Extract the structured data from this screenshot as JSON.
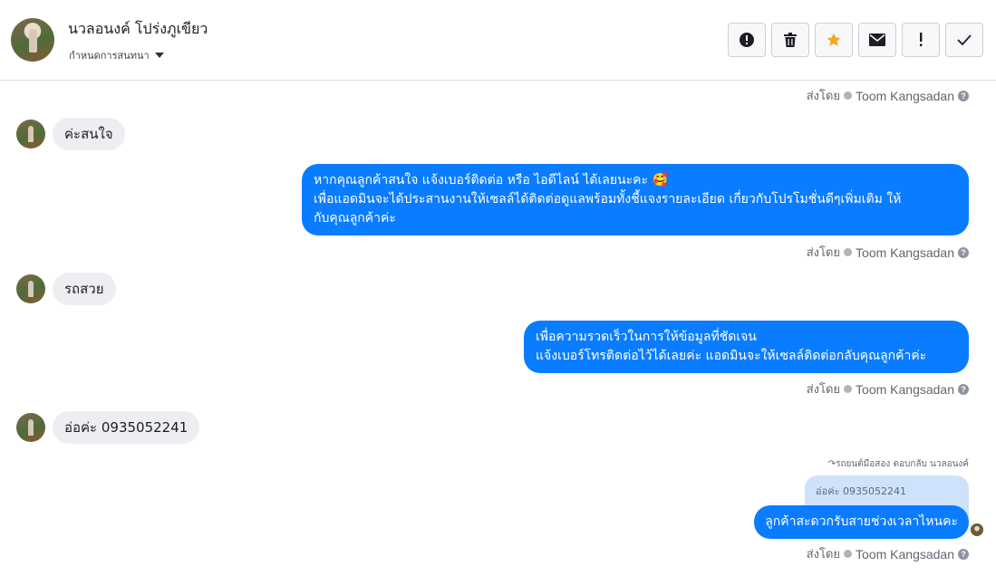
{
  "header": {
    "contact_name": "นวลอนงค์ โปร่งภูเขียว",
    "assign_label": "กำหนดการสนทนา",
    "toolbar": [
      {
        "name": "spam-button",
        "icon": "alert-circle-icon"
      },
      {
        "name": "delete-button",
        "icon": "trash-icon"
      },
      {
        "name": "star-button",
        "icon": "star-icon",
        "color": "#f5a623"
      },
      {
        "name": "mark-unread-button",
        "icon": "envelope-icon"
      },
      {
        "name": "follow-up-button",
        "icon": "exclamation-icon"
      },
      {
        "name": "mark-done-button",
        "icon": "check-icon"
      }
    ]
  },
  "sent_by": {
    "prefix": "ส่งโดย",
    "agent": "Toom Kangsadan",
    "help": "?"
  },
  "messages": {
    "m1": "ค่ะสนใจ",
    "m2_line1": "หากคุณลูกค้าสนใจ แจ้งเบอร์ติดต่อ หรือ ไอดีไลน์ ได้เลยนะคะ 🥰",
    "m2_line2": "เพื่อแอดมินจะได้ประสานงานให้เซลล์ได้ติดต่อดูแลพร้อมทั้งชี้แจงรายละเอียด เกี่ยวกับโปรโมชั่นดีๆเพิ่มเติม ให้",
    "m2_line3": "กับคุณลูกค้าค่ะ",
    "m3": "รถสวย",
    "m4_line1": "เพื่อความรวดเร็วในการให้ข้อมูลที่ชัดเจน",
    "m4_line2": "แจ้งเบอร์โทรติดต่อไว้ได้เลยค่ะ แอดมินจะให้เซลล์ติดต่อกลับคุณลูกค้าค่ะ",
    "m5": "อ่อค่ะ 0935052241",
    "reply_note": "↷รถยนต์มือสอง ตอบกลับ นวลอนงค์",
    "quoted": "อ่อค่ะ 0935052241",
    "m6": "ลูกค้าสะดวกรับสายช่วงเวลาไหนคะ"
  },
  "colors": {
    "outgoing_bubble": "#0a7cff",
    "incoming_bubble": "#eceef1",
    "quoted_bubble": "#cfe2fb"
  }
}
